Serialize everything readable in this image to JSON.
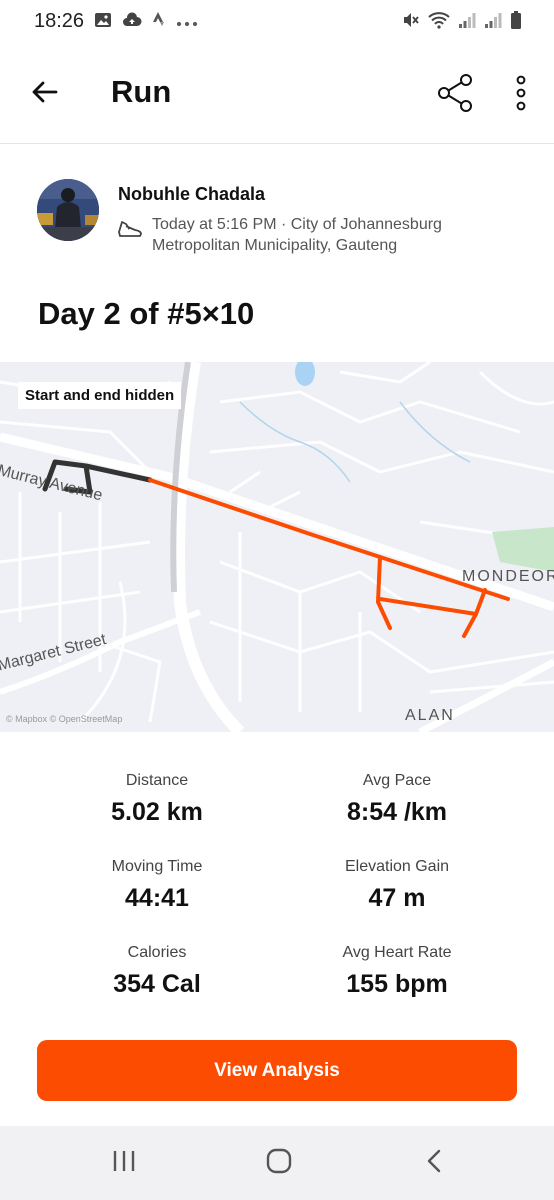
{
  "status_bar": {
    "time": "18:26"
  },
  "app_bar": {
    "title": "Run"
  },
  "athlete": {
    "name": "Nobuhle Chadala",
    "meta": "Today at 5:16 PM · City of Johannesburg Metropolitan Municipality, Gauteng"
  },
  "activity": {
    "title": "Day 2 of #5×10"
  },
  "map": {
    "privacy_badge": "Start and end hidden",
    "labels": {
      "murray": "Murray Avenue",
      "margaret": "Margaret Street",
      "mondeor": "MONDEOR",
      "alan": "ALAN"
    },
    "attribution": "© Mapbox © OpenStreetMap",
    "route_color": "#fc4c02"
  },
  "stats": [
    {
      "label": "Distance",
      "value": "5.02 km"
    },
    {
      "label": "Avg Pace",
      "value": "8:54 /km"
    },
    {
      "label": "Moving Time",
      "value": "44:41"
    },
    {
      "label": "Elevation Gain",
      "value": "47 m"
    },
    {
      "label": "Calories",
      "value": "354 Cal"
    },
    {
      "label": "Avg Heart Rate",
      "value": "155 bpm"
    }
  ],
  "actions": {
    "view_analysis": "View Analysis"
  },
  "colors": {
    "accent": "#fc4c02"
  }
}
